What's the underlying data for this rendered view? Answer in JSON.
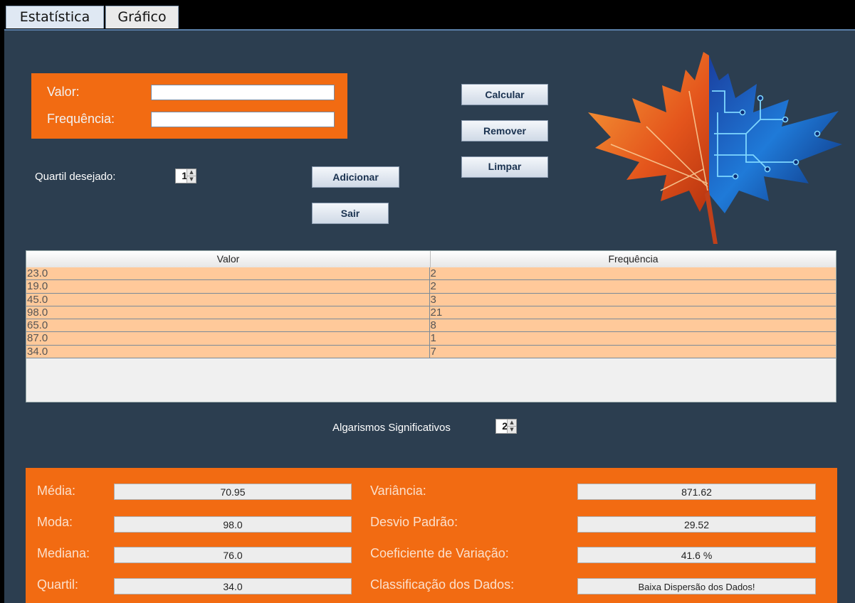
{
  "tabs": [
    {
      "label": "Estatística",
      "active": true
    },
    {
      "label": "Gráfico",
      "active": false
    }
  ],
  "input": {
    "valor_label": "Valor:",
    "valor_value": "",
    "frequencia_label": "Frequência:",
    "frequencia_value": ""
  },
  "quartil": {
    "label": "Quartil desejado:",
    "value": "1"
  },
  "buttons": {
    "adicionar": "Adicionar",
    "sair": "Sair",
    "calcular": "Calcular",
    "remover": "Remover",
    "limpar": "Limpar"
  },
  "table": {
    "headers": [
      "Valor",
      "Frequência"
    ],
    "rows": [
      [
        "23.0",
        "2"
      ],
      [
        "19.0",
        "2"
      ],
      [
        "45.0",
        "3"
      ],
      [
        "98.0",
        "21"
      ],
      [
        "65.0",
        "8"
      ],
      [
        "87.0",
        "1"
      ],
      [
        "34.0",
        "7"
      ]
    ]
  },
  "significant": {
    "label": "Algarismos Significativos",
    "value": "2"
  },
  "results": {
    "media_label": "Média:",
    "media_value": "70.95",
    "moda_label": "Moda:",
    "moda_value": "98.0",
    "mediana_label": "Mediana:",
    "mediana_value": "76.0",
    "quartil_label": "Quartil:",
    "quartil_value": "34.0",
    "variancia_label": "Variância:",
    "variancia_value": "871.62",
    "desvio_label": "Desvio Padrão:",
    "desvio_value": "29.52",
    "coef_label": "Coeficiente de Variação:",
    "coef_value": "41.6 %",
    "class_label": "Classificação dos Dados:",
    "class_value": "Baixa Dispersão dos Dados!"
  },
  "colors": {
    "panel_bg": "#2c3e50",
    "accent_orange": "#f26b12",
    "row_bg": "#ffc99a"
  },
  "logo_icon": "maple-leaf-circuit-logo"
}
